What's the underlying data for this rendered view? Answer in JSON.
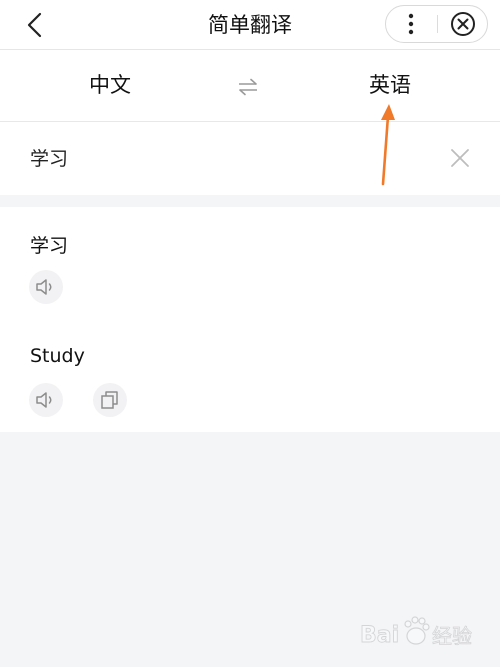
{
  "header": {
    "title": "简单翻译",
    "back_icon": "chevron-left-icon",
    "menu_icon": "more-vertical-icon",
    "close_icon": "close-circle-icon"
  },
  "languages": {
    "source": "中文",
    "target": "英语",
    "swap_icon": "swap-arrows-icon"
  },
  "input": {
    "value": "学习",
    "clear_icon": "close-icon"
  },
  "results": [
    {
      "text": "学习",
      "actions": [
        "speaker-icon"
      ]
    },
    {
      "text": "Study",
      "actions": [
        "speaker-icon",
        "copy-icon"
      ]
    }
  ],
  "annotation": {
    "color": "#f07a2a"
  },
  "watermark": {
    "text": "Bai 经验"
  },
  "colors": {
    "background": "#f4f5f7",
    "surface": "#ffffff",
    "icon_gray": "#9a9a9a",
    "text": "#111111"
  }
}
